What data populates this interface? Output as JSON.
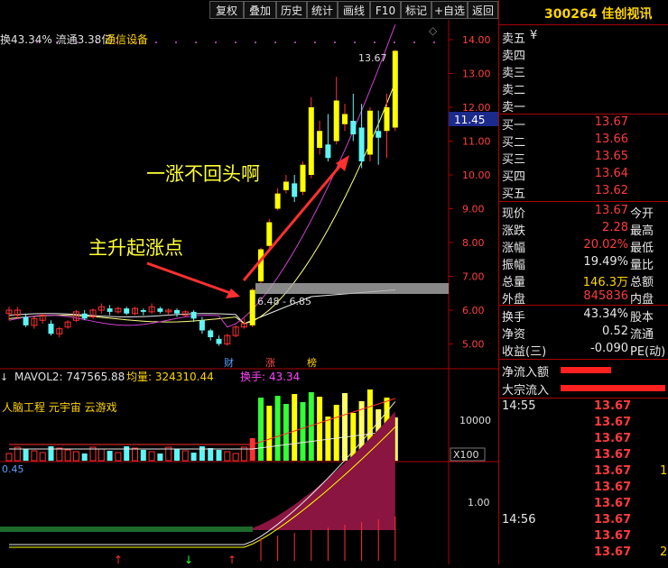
{
  "toolbar": {
    "buttons": [
      "复权",
      "叠加",
      "历史",
      "统计",
      "画线",
      "F10",
      "标记",
      "+自选",
      "返回"
    ]
  },
  "header": {
    "text": "换43.34% 流通3.38亿",
    "sector": "通信设备"
  },
  "price_axis": {
    "ticks": [
      "14.00",
      "13.00",
      "12.00",
      "11.00",
      "10.00",
      "9.00",
      "8.00",
      "7.00",
      "6.00",
      "5.00"
    ],
    "current_tag": "11.45"
  },
  "annotations": {
    "peak_label": "13.67",
    "gap_label": "6.48 - 6.85",
    "rise_text": "一涨不回头啊",
    "start_text": "主升起涨点",
    "badges": [
      "财",
      "涨",
      "榜"
    ]
  },
  "volume": {
    "mavol_text": "MAVOL2: 747565.88",
    "avg_text": "均量: 324310.44",
    "turnover_text": "换手: 43.34",
    "concept_text": "人脑工程 元宇宙 云游戏",
    "axis_tick": "10000",
    "unit": "X100"
  },
  "indicator": {
    "value_text": "0.45",
    "axis_tick": "1.00"
  },
  "panel": {
    "code": "300264",
    "name": "佳创视讯",
    "sell": [
      {
        "label": "卖五",
        "mark": "¥"
      },
      {
        "label": "卖四"
      },
      {
        "label": "卖三"
      },
      {
        "label": "卖二"
      },
      {
        "label": "卖一"
      }
    ],
    "buy": [
      {
        "label": "买一",
        "value": "13.67"
      },
      {
        "label": "买二",
        "value": "13.66"
      },
      {
        "label": "买三",
        "value": "13.65"
      },
      {
        "label": "买四",
        "value": "13.64"
      },
      {
        "label": "买五",
        "value": "13.62"
      }
    ],
    "quote": [
      {
        "label": "现价",
        "value": "13.67",
        "label2": "今开",
        "color": "red"
      },
      {
        "label": "涨跌",
        "value": "2.28",
        "label2": "最高",
        "color": "red"
      },
      {
        "label": "涨幅",
        "value": "20.02%",
        "label2": "最低",
        "color": "red"
      },
      {
        "label": "振幅",
        "value": "19.49%",
        "label2": "量比",
        "color": "wht"
      },
      {
        "label": "总量",
        "value": "146.3万",
        "label2": "总额",
        "color": "yel"
      },
      {
        "label": "外盘",
        "value": "845836",
        "label2": "内盘",
        "color": "red"
      }
    ],
    "stats": [
      {
        "label": "换手",
        "value": "43.34%",
        "label2": "股本"
      },
      {
        "label": "净资",
        "value": "0.52",
        "label2": "流通"
      },
      {
        "label": "收益(三)",
        "value": "-0.090",
        "label2": "PE(动)"
      }
    ],
    "flows": [
      "净流入额",
      "大宗流入"
    ],
    "trades": [
      {
        "time": "14:55",
        "price": "13.67",
        "vol": ""
      },
      {
        "time": "",
        "price": "13.67",
        "vol": ""
      },
      {
        "time": "",
        "price": "13.67",
        "vol": ""
      },
      {
        "time": "",
        "price": "13.67",
        "vol": ""
      },
      {
        "time": "",
        "price": "13.67",
        "vol": "1"
      },
      {
        "time": "",
        "price": "13.67",
        "vol": ""
      },
      {
        "time": "",
        "price": "13.67",
        "vol": ""
      },
      {
        "time": "14:56",
        "price": "13.67",
        "vol": ""
      },
      {
        "time": "",
        "price": "13.67",
        "vol": ""
      },
      {
        "time": "",
        "price": "13.67",
        "vol": "2"
      }
    ]
  }
}
